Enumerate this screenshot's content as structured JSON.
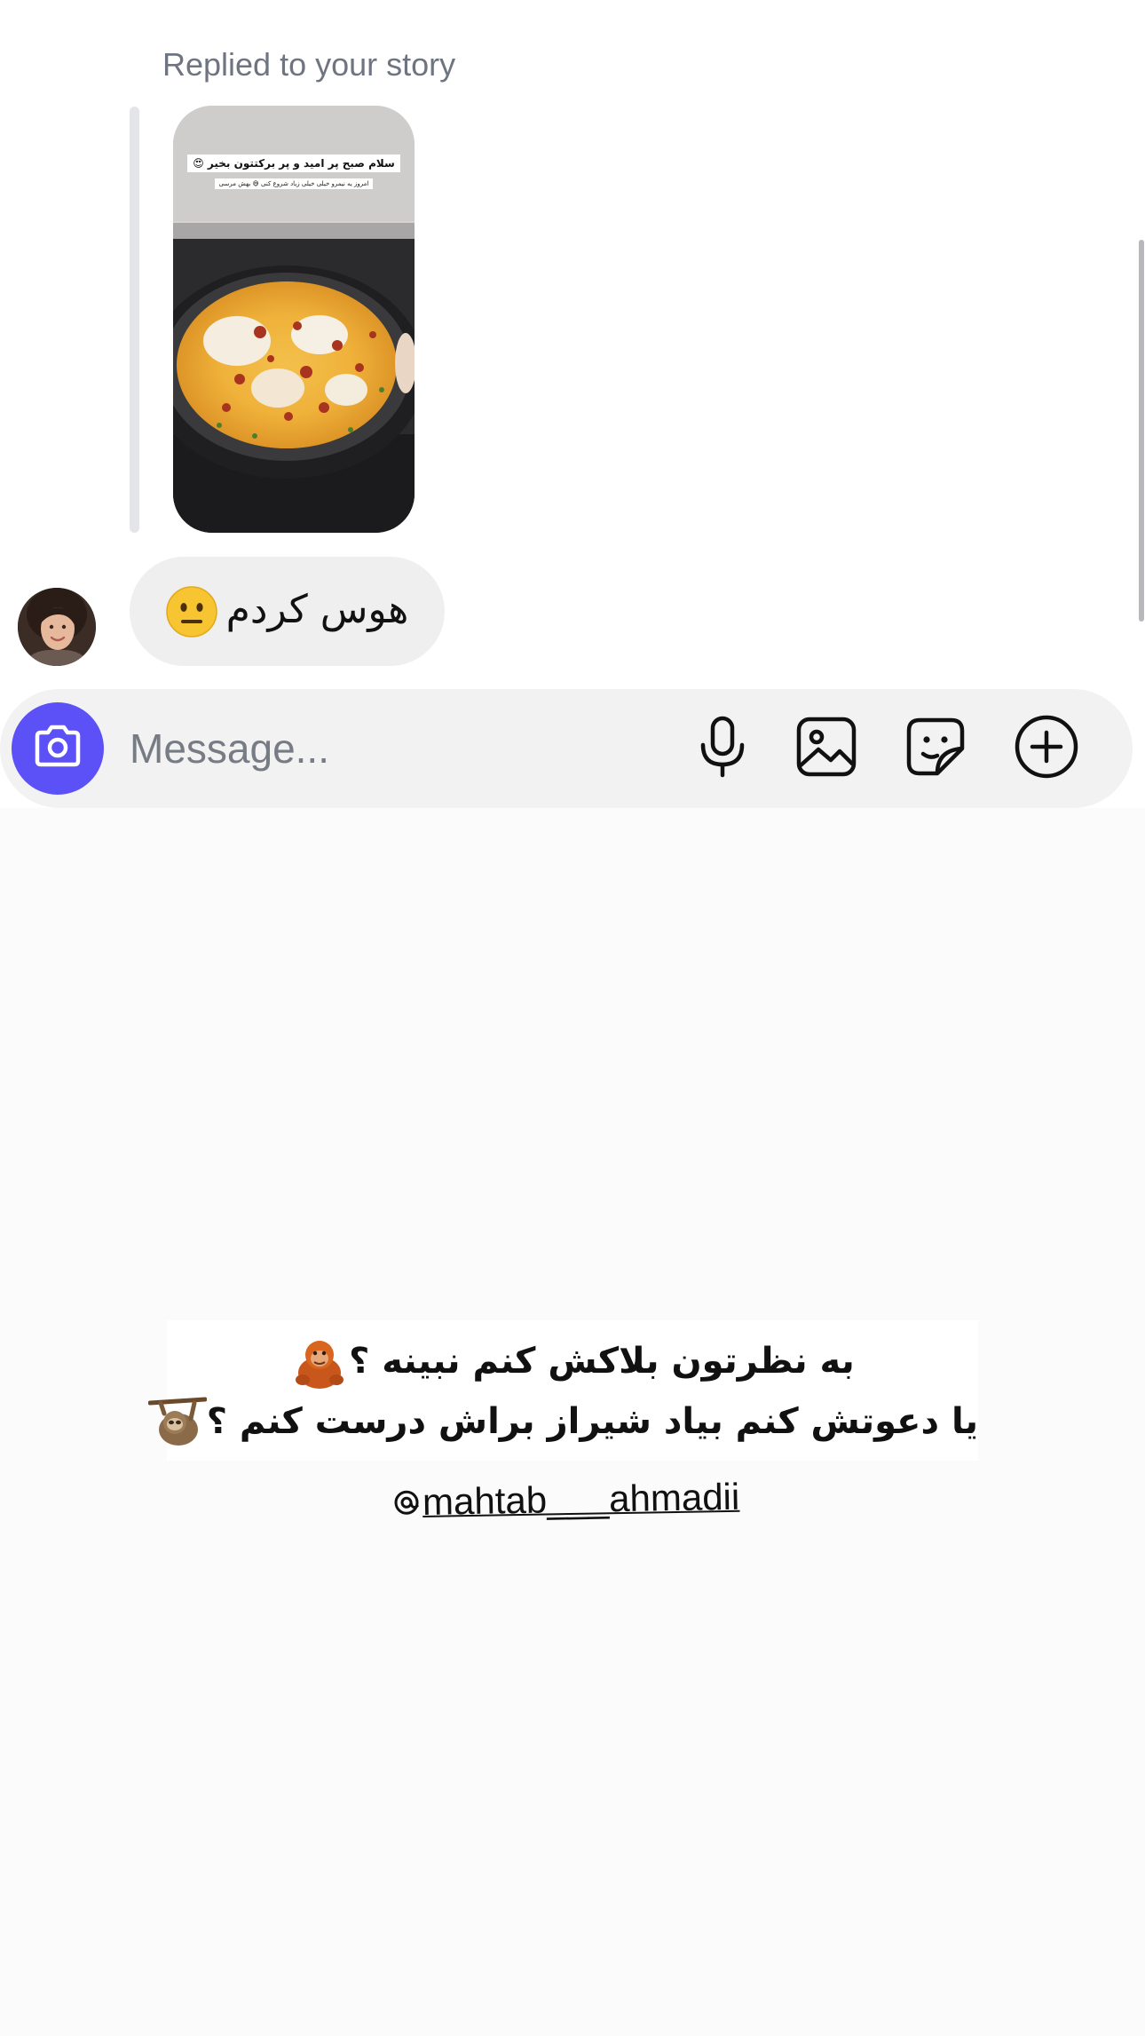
{
  "conversation": {
    "reply_context_label": "Replied to your story",
    "story_preview": {
      "caption_line_1": "سلام صبح پر امید و پر برکتتون بخیر 😍",
      "caption_line_2": "امروز یه نیمرو خیلی خیلی زیاد شروع کنی 😅 بهش مرسی"
    },
    "message": {
      "text": "هوس کردم",
      "emoji_icon": "neutral-face-emoji"
    }
  },
  "composer": {
    "placeholder": "Message...",
    "camera_icon": "camera-icon",
    "icons": [
      "microphone-icon",
      "gallery-icon",
      "sticker-icon",
      "add-icon"
    ],
    "accent_color": "#5b51f6"
  },
  "story_overlay": {
    "line_1": "به نظرتون بلاکش کنم نبینه ؟",
    "line_1_emoji": "orangutan-emoji",
    "line_2": "یا دعوتش کنم بیاد شیراز براش درست کنم ؟",
    "line_2_emoji": "sloth-emoji",
    "mention_icon": "threads-icon",
    "mention": "mahtab___ahmadii"
  }
}
